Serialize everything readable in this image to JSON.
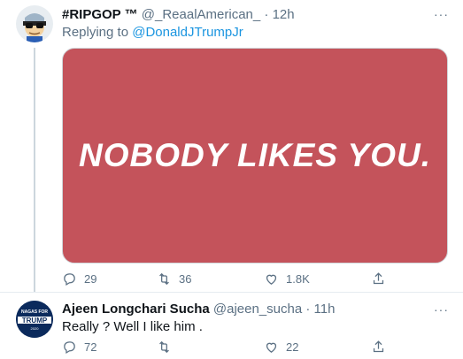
{
  "tweet1": {
    "display_name": "#RIPGOP ™",
    "handle": "@_ReaalAmerican_",
    "separator": "·",
    "time": "12h",
    "replying_prefix": "Replying to",
    "replying_to": "@DonaldJTrumpJr",
    "media_text": "NOBODY LIKES YOU.",
    "media_color": "#c4535b",
    "replies": "29",
    "retweets": "36",
    "likes": "1.8K",
    "more_label": "···"
  },
  "tweet2": {
    "display_name": "Ajeen Longchari Sucha",
    "handle": "@ajeen_sucha",
    "separator": "·",
    "time": "11h",
    "text": "Really ? Well I like him .",
    "replies": "72",
    "retweets": "",
    "likes": "22",
    "more_label": "···",
    "avatar_text_top": "NAGAS FOR",
    "avatar_text_main": "TRUMP",
    "avatar_text_year": "2020"
  },
  "colors": {
    "link": "#1b95e0",
    "muted": "#5b7083",
    "divider": "#e6ecf0"
  },
  "icons": [
    "reply-icon",
    "retweet-icon",
    "like-icon",
    "share-icon",
    "more-icon"
  ]
}
